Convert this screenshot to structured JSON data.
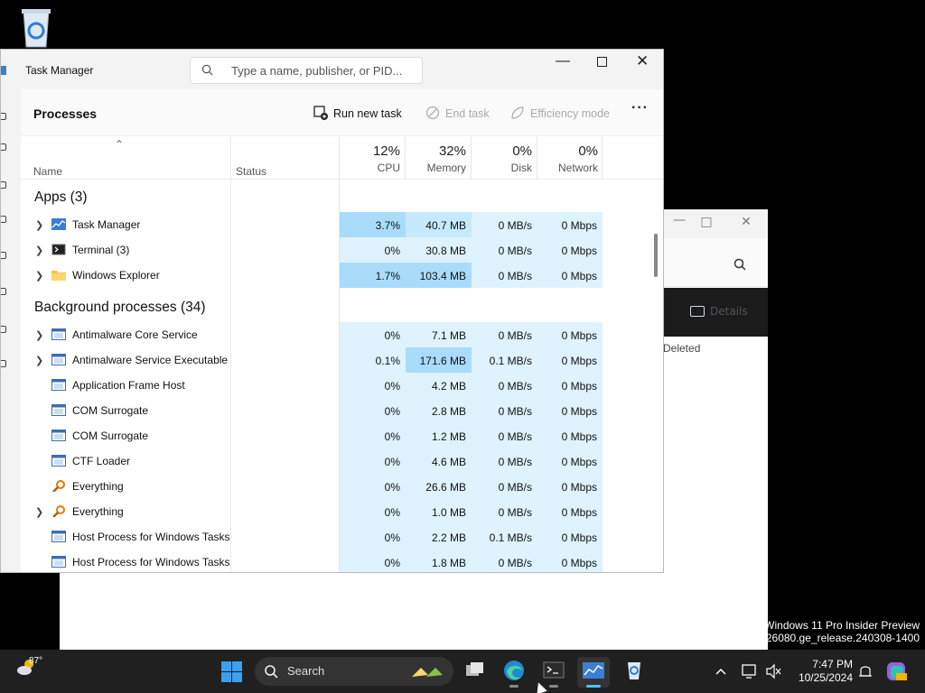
{
  "desktop": {
    "recycle_bin_icon": "recycle-bin-icon"
  },
  "background_window": {
    "details_label": "Details",
    "deleted_label": "Deleted"
  },
  "watermark": {
    "line1": "Windows 11 Pro Insider Preview",
    "line2": "ld 26080.ge_release.240308-1400"
  },
  "task_manager": {
    "title": "Task Manager",
    "search_placeholder": "Type a name, publisher, or PID...",
    "page_title": "Processes",
    "commands": {
      "run_new_task": "Run new task",
      "end_task": "End task",
      "efficiency_mode": "Efficiency mode"
    },
    "headers": {
      "name": "Name",
      "status": "Status",
      "cpu_pct": "12%",
      "cpu": "CPU",
      "memory_pct": "32%",
      "memory": "Memory",
      "disk_pct": "0%",
      "disk": "Disk",
      "network_pct": "0%",
      "network": "Network"
    },
    "groups": {
      "apps": "Apps (3)",
      "background": "Background processes (34)"
    },
    "apps": [
      {
        "name": "Task Manager",
        "cpu": "3.7%",
        "memory": "40.7 MB",
        "disk": "0 MB/s",
        "network": "0 Mbps"
      },
      {
        "name": "Terminal (3)",
        "cpu": "0%",
        "memory": "30.8 MB",
        "disk": "0 MB/s",
        "network": "0 Mbps"
      },
      {
        "name": "Windows Explorer",
        "cpu": "1.7%",
        "memory": "103.4 MB",
        "disk": "0 MB/s",
        "network": "0 Mbps"
      }
    ],
    "background": [
      {
        "name": "Antimalware Core Service",
        "cpu": "0%",
        "memory": "7.1 MB",
        "disk": "0 MB/s",
        "network": "0 Mbps"
      },
      {
        "name": "Antimalware Service Executable",
        "cpu": "0.1%",
        "memory": "171.6 MB",
        "disk": "0.1 MB/s",
        "network": "0 Mbps"
      },
      {
        "name": "Application Frame Host",
        "cpu": "0%",
        "memory": "4.2 MB",
        "disk": "0 MB/s",
        "network": "0 Mbps"
      },
      {
        "name": "COM Surrogate",
        "cpu": "0%",
        "memory": "2.8 MB",
        "disk": "0 MB/s",
        "network": "0 Mbps"
      },
      {
        "name": "COM Surrogate",
        "cpu": "0%",
        "memory": "1.2 MB",
        "disk": "0 MB/s",
        "network": "0 Mbps"
      },
      {
        "name": "CTF Loader",
        "cpu": "0%",
        "memory": "4.6 MB",
        "disk": "0 MB/s",
        "network": "0 Mbps"
      },
      {
        "name": "Everything",
        "cpu": "0%",
        "memory": "26.6 MB",
        "disk": "0 MB/s",
        "network": "0 Mbps"
      },
      {
        "name": "Everything",
        "cpu": "0%",
        "memory": "1.0 MB",
        "disk": "0 MB/s",
        "network": "0 Mbps"
      },
      {
        "name": "Host Process for Windows Tasks",
        "cpu": "0%",
        "memory": "2.2 MB",
        "disk": "0.1 MB/s",
        "network": "0 Mbps"
      },
      {
        "name": "Host Process for Windows Tasks",
        "cpu": "0%",
        "memory": "1.8 MB",
        "disk": "0 MB/s",
        "network": "0 Mbps"
      }
    ]
  },
  "taskbar": {
    "temperature": "87°",
    "search_label": "Search",
    "time": "7:47 PM",
    "date": "10/25/2024",
    "pinned_apps": [
      "task-view-icon",
      "edge-icon",
      "terminal-icon",
      "task-manager-icon",
      "recycle-bin-icon"
    ]
  },
  "colors": {
    "heat_low": "#def3fe",
    "heat_mid": "#c7e9fd",
    "heat_high": "#a9dcfb",
    "taskbar_bg": "#202020",
    "accent": "#4cc2ff"
  }
}
